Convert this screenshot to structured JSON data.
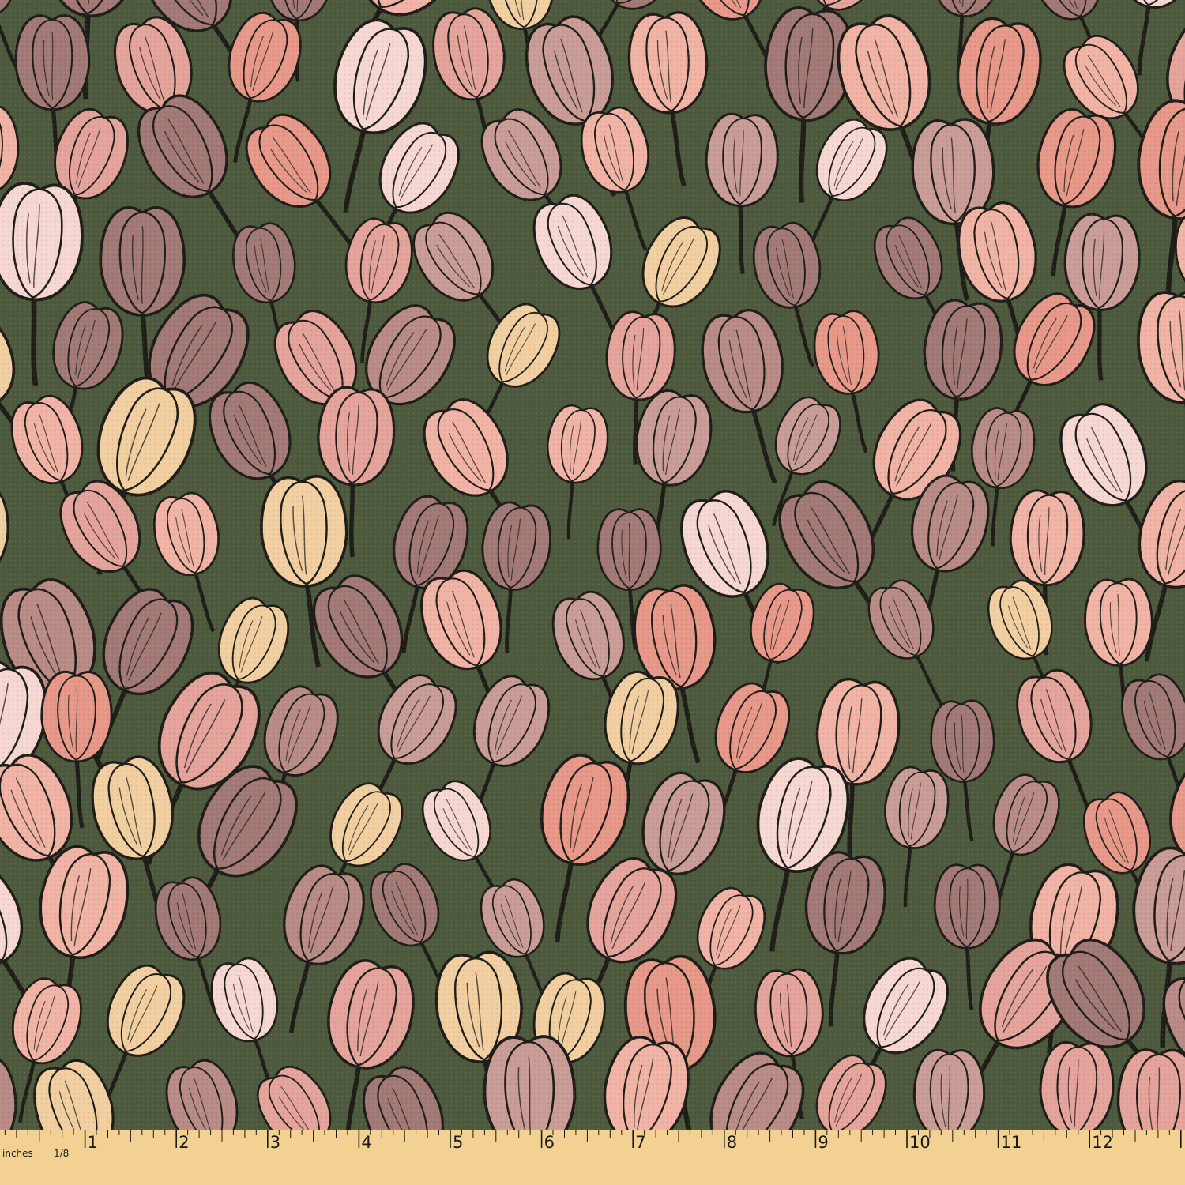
{
  "fabric": {
    "colors": {
      "background": "#4d5a3e",
      "outline": "#1f1d18",
      "petals": [
        "#f0b3a5",
        "#e4a39b",
        "#b98b86",
        "#a27976",
        "#f2cfa1",
        "#f6d7d2",
        "#e79888",
        "#c99c97"
      ]
    },
    "icon": "tulip-flower-pattern"
  },
  "ruler": {
    "unit_label": "inches",
    "fraction_label": "1/8",
    "numbers": [
      "1",
      "2",
      "3",
      "4",
      "5",
      "6",
      "7",
      "8",
      "9",
      "10",
      "11",
      "12",
      "1"
    ],
    "colors": {
      "fill": "#f2d193",
      "ink": "#1c1a14"
    }
  }
}
